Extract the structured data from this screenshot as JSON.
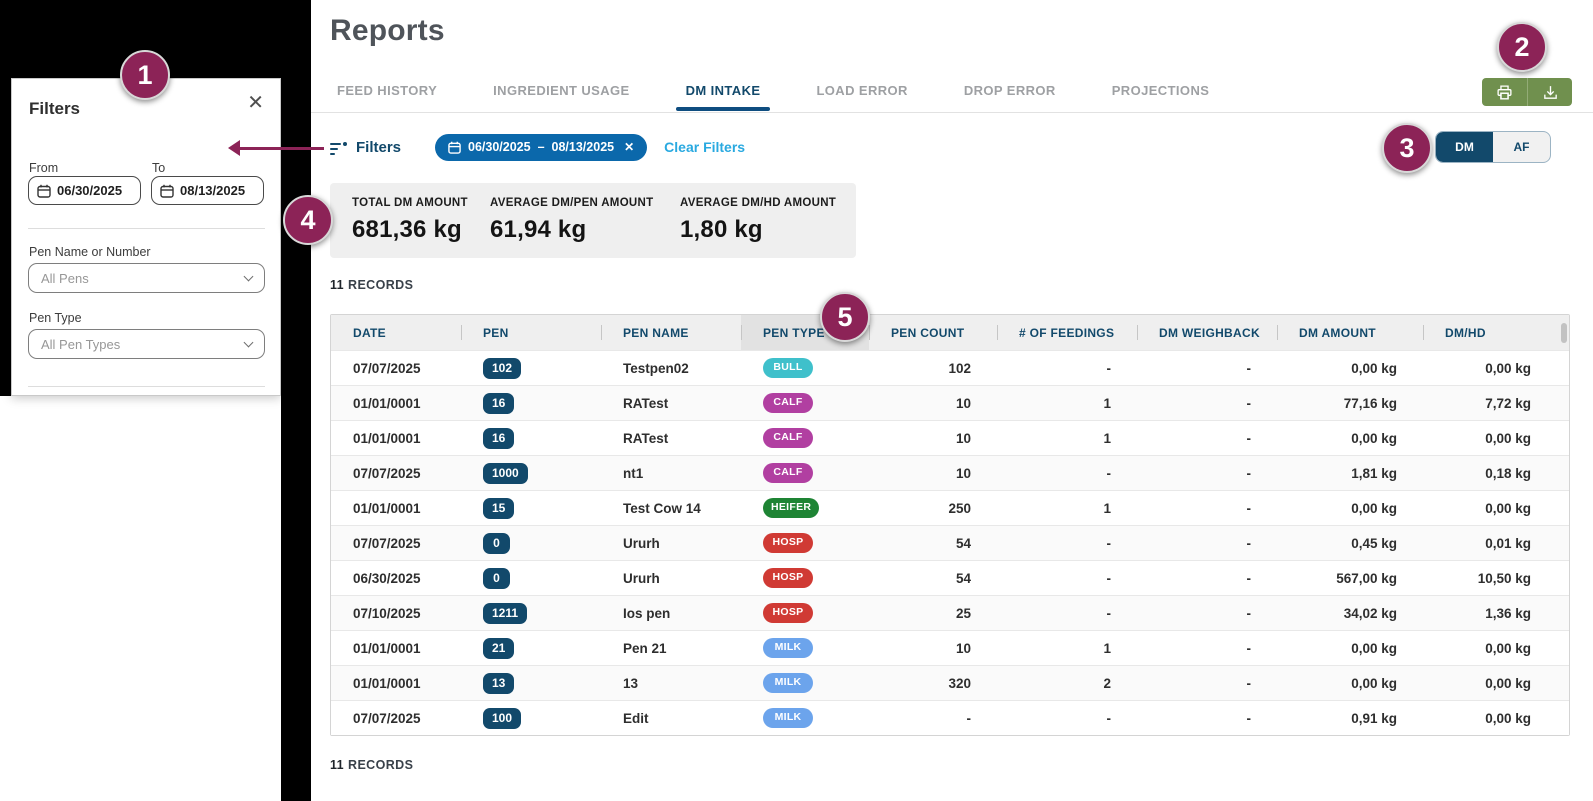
{
  "brand": {
    "accent_maroon": "#8C2357",
    "dark_blue": "#12496B",
    "active_tab_underline": "#0E4D80",
    "chip_blue": "#0B68AB",
    "link_blue": "#29A9E0",
    "export_button_green": "#70904E",
    "table_header_gray": "#EFEFEF"
  },
  "icons": {
    "filter": "filter-lines-icon",
    "calendar": "calendar-icon",
    "close": "✕",
    "chip_remove": "✕",
    "chevron_down": "chevron-down-icon",
    "sort_ascending": "chevron-up-icon",
    "print": "printer-icon",
    "download": "download-tray-icon"
  },
  "page": {
    "title": "Reports"
  },
  "tabs": [
    {
      "label": "FEED HISTORY",
      "active": false
    },
    {
      "label": "INGREDIENT USAGE",
      "active": false
    },
    {
      "label": "DM INTAKE",
      "active": true
    },
    {
      "label": "LOAD ERROR",
      "active": false
    },
    {
      "label": "DROP ERROR",
      "active": false
    },
    {
      "label": "PROJECTIONS",
      "active": false
    }
  ],
  "filter_panel": {
    "title": "Filters",
    "from_label": "From",
    "from_value": "06/30/2025",
    "to_label": "To",
    "to_value": "08/13/2025",
    "pen_name_label": "Pen Name or Number",
    "pen_name_value": "All Pens",
    "pen_type_label": "Pen Type",
    "pen_type_value": "All Pen Types"
  },
  "filters_bar": {
    "label": "Filters",
    "date_chip": {
      "from": "06/30/2025",
      "dash": "–",
      "to": "08/13/2025",
      "remove": "✕"
    },
    "clear_label": "Clear Filters"
  },
  "unit_toggle": {
    "options": [
      {
        "label": "DM",
        "active": true
      },
      {
        "label": "AF",
        "active": false
      }
    ]
  },
  "stats": [
    {
      "label": "TOTAL DM AMOUNT",
      "value": "681,36 kg"
    },
    {
      "label": "AVERAGE DM/PEN AMOUNT",
      "value": "61,94 kg"
    },
    {
      "label": "AVERAGE DM/HD AMOUNT",
      "value": "1,80 kg"
    }
  ],
  "records": {
    "top_count": "11",
    "bottom_count": "11",
    "label": "RECORDS"
  },
  "pen_type_colors": {
    "BULL": "#3FC0CB",
    "CALF": "#B13FA1",
    "HEIFER": "#1E8434",
    "HOSP": "#D03A34",
    "MILK": "#6CA4EC"
  },
  "table": {
    "columns": [
      {
        "label": "DATE",
        "align": "left"
      },
      {
        "label": "PEN",
        "align": "left"
      },
      {
        "label": "PEN NAME",
        "align": "left"
      },
      {
        "label": "PEN TYPE",
        "align": "left",
        "sorted": "asc"
      },
      {
        "label": "PEN COUNT",
        "align": "right"
      },
      {
        "label": "# OF FEEDINGS",
        "align": "right"
      },
      {
        "label": "DM WEIGHBACK",
        "align": "right"
      },
      {
        "label": "DM AMOUNT",
        "align": "right"
      },
      {
        "label": "DM/HD",
        "align": "right"
      }
    ],
    "rows": [
      {
        "date": "07/07/2025",
        "pen": "102",
        "pen_name": "Testpen02",
        "pen_type": "BULL",
        "pen_count": "102",
        "feedings": "-",
        "weighback": "-",
        "dm_amount": "0,00 kg",
        "dm_hd": "0,00 kg"
      },
      {
        "date": "01/01/0001",
        "pen": "16",
        "pen_name": "RATest",
        "pen_type": "CALF",
        "pen_count": "10",
        "feedings": "1",
        "weighback": "-",
        "dm_amount": "77,16 kg",
        "dm_hd": "7,72 kg"
      },
      {
        "date": "01/01/0001",
        "pen": "16",
        "pen_name": "RATest",
        "pen_type": "CALF",
        "pen_count": "10",
        "feedings": "1",
        "weighback": "-",
        "dm_amount": "0,00 kg",
        "dm_hd": "0,00 kg"
      },
      {
        "date": "07/07/2025",
        "pen": "1000",
        "pen_name": "nt1",
        "pen_type": "CALF",
        "pen_count": "10",
        "feedings": "-",
        "weighback": "-",
        "dm_amount": "1,81 kg",
        "dm_hd": "0,18 kg"
      },
      {
        "date": "01/01/0001",
        "pen": "15",
        "pen_name": "Test Cow 14",
        "pen_type": "HEIFER",
        "pen_count": "250",
        "feedings": "1",
        "weighback": "-",
        "dm_amount": "0,00 kg",
        "dm_hd": "0,00 kg"
      },
      {
        "date": "07/07/2025",
        "pen": "0",
        "pen_name": "Ururh",
        "pen_type": "HOSP",
        "pen_count": "54",
        "feedings": "-",
        "weighback": "-",
        "dm_amount": "0,45 kg",
        "dm_hd": "0,01 kg"
      },
      {
        "date": "06/30/2025",
        "pen": "0",
        "pen_name": "Ururh",
        "pen_type": "HOSP",
        "pen_count": "54",
        "feedings": "-",
        "weighback": "-",
        "dm_amount": "567,00 kg",
        "dm_hd": "10,50 kg"
      },
      {
        "date": "07/10/2025",
        "pen": "1211",
        "pen_name": "Ios pen",
        "pen_type": "HOSP",
        "pen_count": "25",
        "feedings": "-",
        "weighback": "-",
        "dm_amount": "34,02 kg",
        "dm_hd": "1,36 kg"
      },
      {
        "date": "01/01/0001",
        "pen": "21",
        "pen_name": "Pen 21",
        "pen_type": "MILK",
        "pen_count": "10",
        "feedings": "1",
        "weighback": "-",
        "dm_amount": "0,00 kg",
        "dm_hd": "0,00 kg"
      },
      {
        "date": "01/01/0001",
        "pen": "13",
        "pen_name": "13",
        "pen_type": "MILK",
        "pen_count": "320",
        "feedings": "2",
        "weighback": "-",
        "dm_amount": "0,00 kg",
        "dm_hd": "0,00 kg"
      },
      {
        "date": "07/07/2025",
        "pen": "100",
        "pen_name": "Edit",
        "pen_type": "MILK",
        "pen_count": "-",
        "feedings": "-",
        "weighback": "-",
        "dm_amount": "0,91 kg",
        "dm_hd": "0,00 kg"
      }
    ]
  },
  "annotations": {
    "badges": [
      "1",
      "2",
      "3",
      "4",
      "5"
    ]
  }
}
